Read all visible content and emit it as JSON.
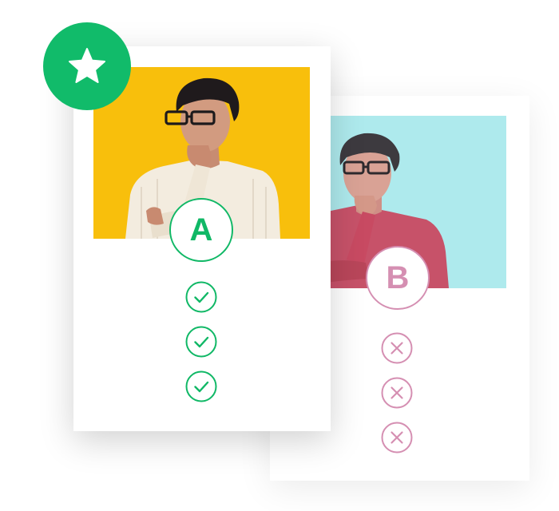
{
  "variant_a": {
    "label": "A",
    "accent_color": "#10b866",
    "photo_background": "#f8bf0c",
    "shirt_color": "#f3ecdf",
    "marks": [
      "check-icon",
      "check-icon",
      "check-icon"
    ]
  },
  "variant_b": {
    "label": "B",
    "accent_color": "#d58fb2",
    "photo_background": "#aeeaed",
    "shirt_color": "#c84a62",
    "marks": [
      "x-icon",
      "x-icon",
      "x-icon"
    ]
  },
  "winner_badge": {
    "icon": "star-icon",
    "color": "#11bb6a"
  }
}
